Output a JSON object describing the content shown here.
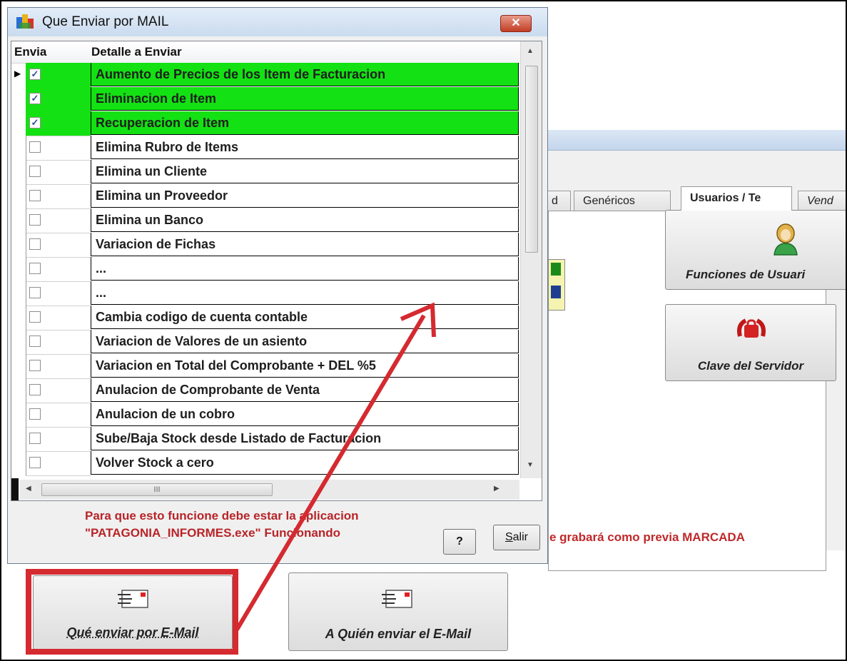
{
  "dialog": {
    "title": "Que Enviar por MAIL",
    "close_label": "✕",
    "columns": {
      "envia": "Envia",
      "detalle": "Detalle a Enviar"
    },
    "rows": [
      {
        "label": "Aumento de Precios de los Item de Facturacion",
        "checked": true,
        "highlight": true
      },
      {
        "label": "Eliminacion de Item",
        "checked": true,
        "highlight": true
      },
      {
        "label": "Recuperacion de Item",
        "checked": true,
        "highlight": true
      },
      {
        "label": "Elimina Rubro de Items",
        "checked": false,
        "highlight": false
      },
      {
        "label": "Elimina un Cliente",
        "checked": false,
        "highlight": false
      },
      {
        "label": "Elimina un Proveedor",
        "checked": false,
        "highlight": false
      },
      {
        "label": "Elimina un Banco",
        "checked": false,
        "highlight": false
      },
      {
        "label": "Variacion de Fichas",
        "checked": false,
        "highlight": false
      },
      {
        "label": "...",
        "checked": false,
        "highlight": false
      },
      {
        "label": "...",
        "checked": false,
        "highlight": false
      },
      {
        "label": "Cambia codigo de cuenta contable",
        "checked": false,
        "highlight": false
      },
      {
        "label": "Variacion de Valores de un asiento",
        "checked": false,
        "highlight": false
      },
      {
        "label": "Variacion en Total del Comprobante + DEL %5",
        "checked": false,
        "highlight": false
      },
      {
        "label": "Anulacion de Comprobante de Venta",
        "checked": false,
        "highlight": false
      },
      {
        "label": "Anulacion de un cobro",
        "checked": false,
        "highlight": false
      },
      {
        "label": "Sube/Baja Stock desde Listado de Facturacion",
        "checked": false,
        "highlight": false
      },
      {
        "label": "Volver Stock a cero",
        "checked": false,
        "highlight": false
      }
    ],
    "note": "Para que esto funcione debe estar la aplicacion \"PATAGONIA_INFORMES.exe\" Funcionando",
    "help_label": "?",
    "exit_label": "Salir",
    "exit_label_underline": "S",
    "exit_label_rest": "alir"
  },
  "background": {
    "tabs": [
      "d",
      "Genéricos",
      "Usuarios / Te",
      "Vend"
    ],
    "active_tab": "Usuarios / Te",
    "buttons": {
      "users": "Funciones de Usuari",
      "server_key": "Clave del Servidor"
    },
    "message": "e grabará como previa MARCADA"
  },
  "mail_buttons": {
    "what": "Qué enviar por E-Mail",
    "whom": "A Quién enviar el E-Mail"
  },
  "colors": {
    "highlight_green": "#13e113",
    "annotation_red": "#d42a30",
    "message_red": "#c0282a"
  }
}
